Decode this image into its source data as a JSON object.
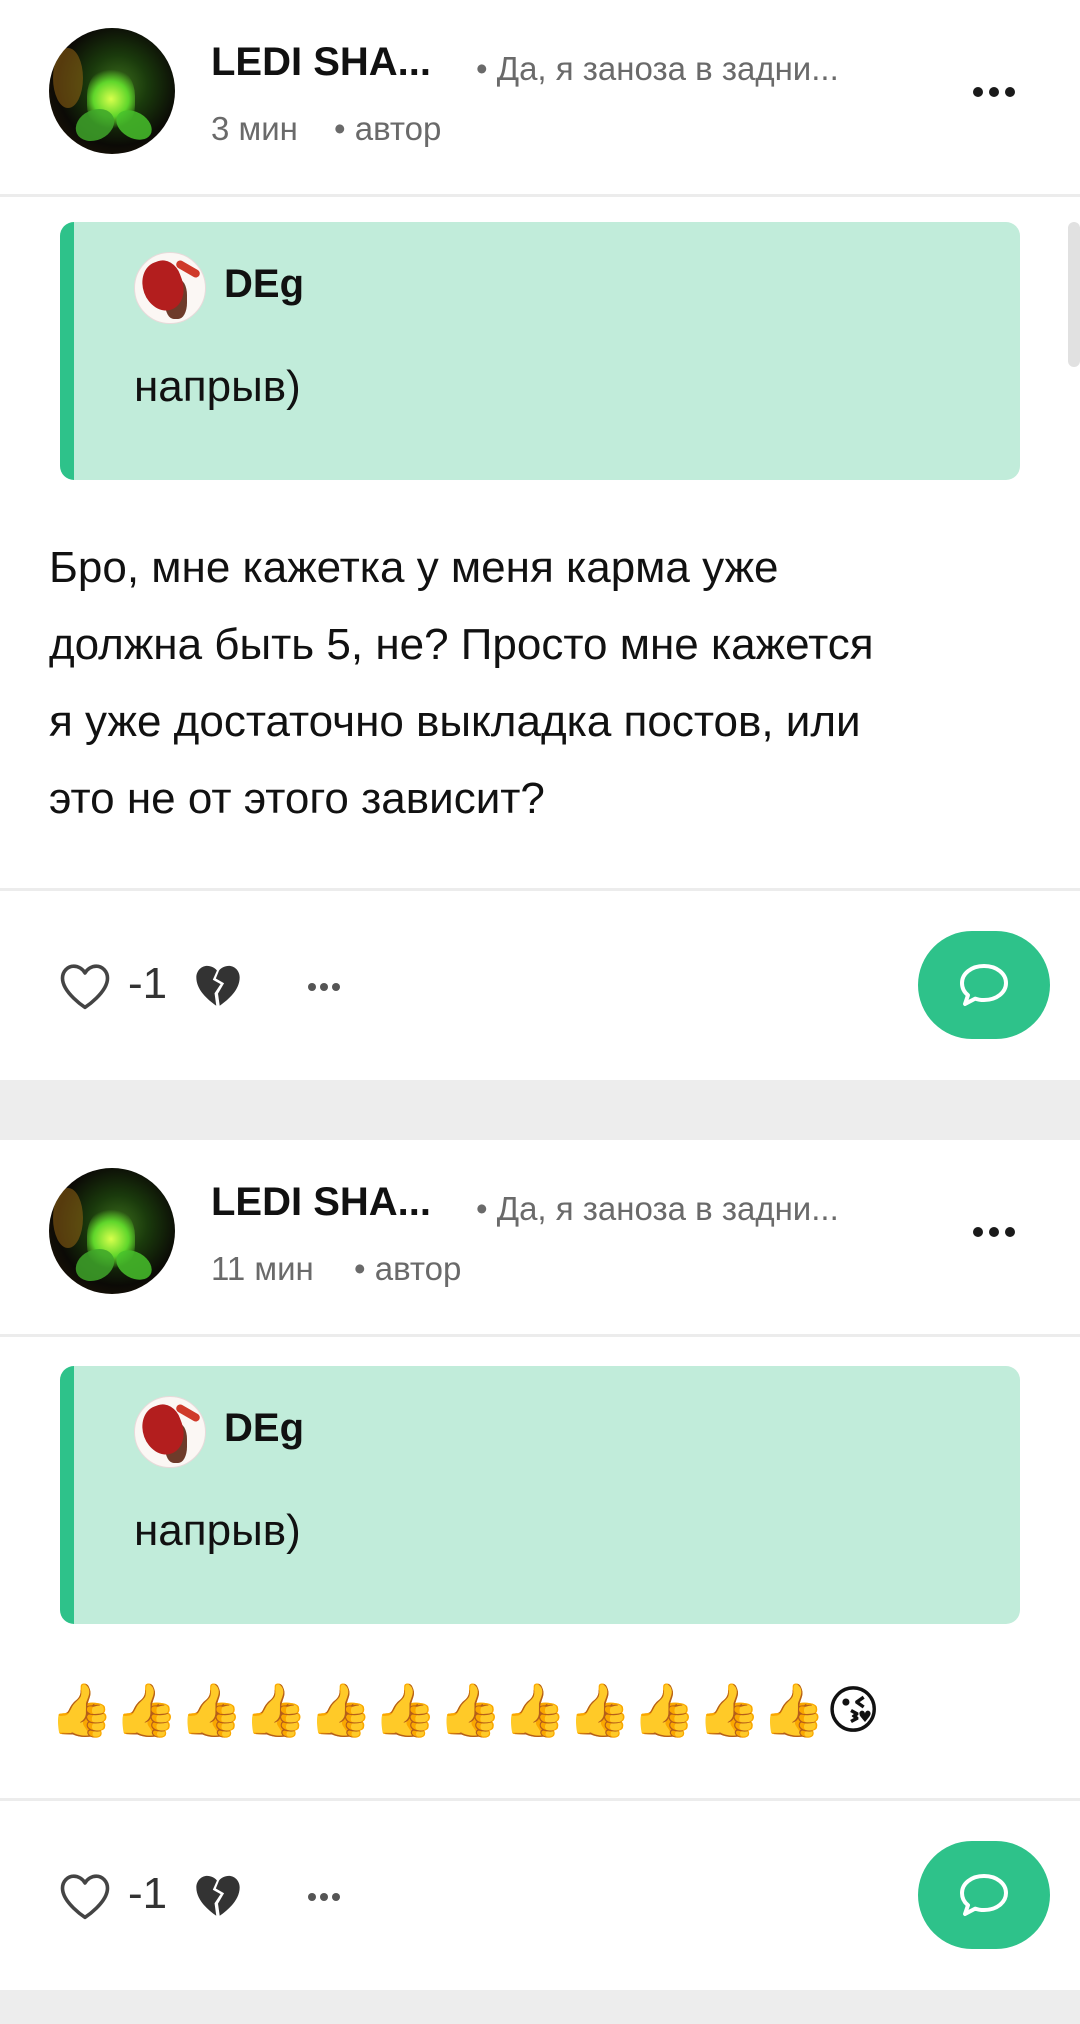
{
  "colors": {
    "accent": "#2ec28a",
    "quote_bg": "#c1ecda",
    "page_bg": "#ededed",
    "muted_text": "#6a6a6a"
  },
  "posts": [
    {
      "author": {
        "name": "LEDI SHA...",
        "status": "• Да, я заноза в задни..."
      },
      "meta": {
        "time": "3 мин",
        "role": "• автор"
      },
      "quote": {
        "author": "DEg",
        "text": "напрыв)"
      },
      "body_lines": [
        "Бро, мне кажетка у меня карма уже",
        "должна быть 5, не? Просто мне кажется",
        "я уже достаточно выкладка постов, или",
        "это не от этого зависит?"
      ],
      "actions": {
        "score": "-1",
        "like_icon": "heart-outline-icon",
        "dislike_icon": "broken-heart-icon",
        "more_icon": "more-horizontal-icon",
        "reply_icon": "chat-bubble-icon"
      }
    },
    {
      "author": {
        "name": "LEDI SHA...",
        "status": "• Да, я заноза в задни..."
      },
      "meta": {
        "time": "11 мин",
        "role": "• автор"
      },
      "quote": {
        "author": "DEg",
        "text": "напрыв)"
      },
      "body_emoji": "👍👍👍👍👍👍👍👍👍👍👍👍😘",
      "actions": {
        "score": "-1",
        "like_icon": "heart-outline-icon",
        "dislike_icon": "broken-heart-icon",
        "more_icon": "more-horizontal-icon",
        "reply_icon": "chat-bubble-icon"
      }
    }
  ]
}
